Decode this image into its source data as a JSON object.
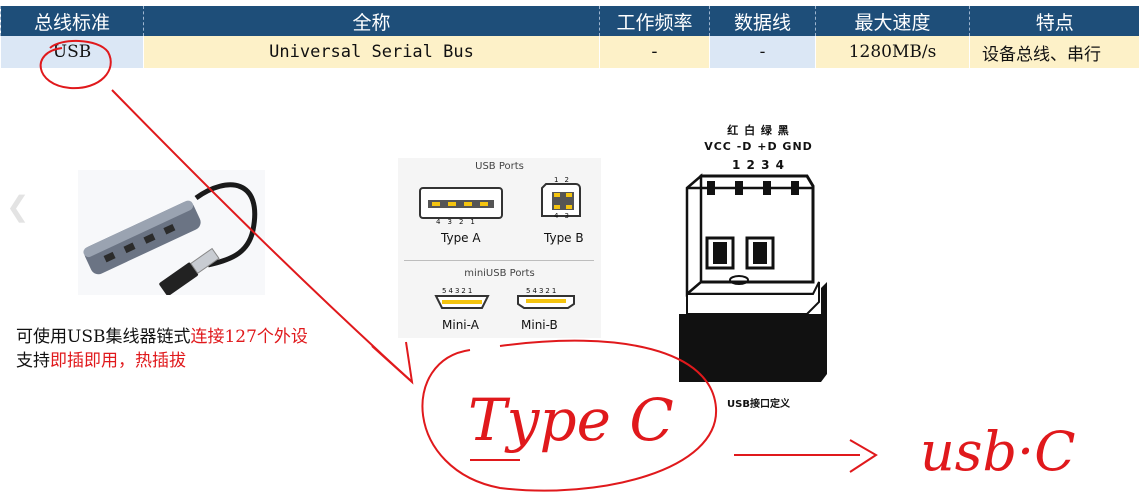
{
  "table": {
    "headers": [
      "总线标准",
      "全称",
      "工作频率",
      "数据线",
      "最大速度",
      "特点"
    ],
    "row": {
      "standard": "USB",
      "full_name": "Universal Serial Bus",
      "frequency": "-",
      "data_lines": "-",
      "max_speed": "1280MB/s",
      "feature": "设备总线、串行"
    }
  },
  "ports_figure": {
    "usb_title": "USB Ports",
    "type_a": "Type A",
    "type_b": "Type B",
    "mini_title": "miniUSB Ports",
    "mini_a": "Mini-A",
    "mini_b": "Mini-B",
    "a_pins": [
      "4",
      "3",
      "2",
      "1"
    ],
    "b_pins_top": [
      "1",
      "2"
    ],
    "b_pins_bottom": [
      "4",
      "3"
    ],
    "mini_pins": [
      "5",
      "4",
      "3",
      "2",
      "1"
    ]
  },
  "plug_figure": {
    "colors": "红 白 绿 黑",
    "signals": "VCC -D +D GND",
    "numbers": "1 2 3 4",
    "caption": "USB接口定义"
  },
  "note": {
    "line1_prefix": "可使用USB集线器链式",
    "line1_red": "连接127个外设",
    "line2_prefix": "支持",
    "line2_red": "即插即用，热插拔"
  },
  "handwriting": {
    "type_c": "Type C",
    "usb_c": "usb·C"
  },
  "colors": {
    "header_bg": "#1e4e79",
    "row_blue": "#dbe7f5",
    "row_yellow": "#fdf1c8",
    "ink_red": "#e0191c"
  }
}
